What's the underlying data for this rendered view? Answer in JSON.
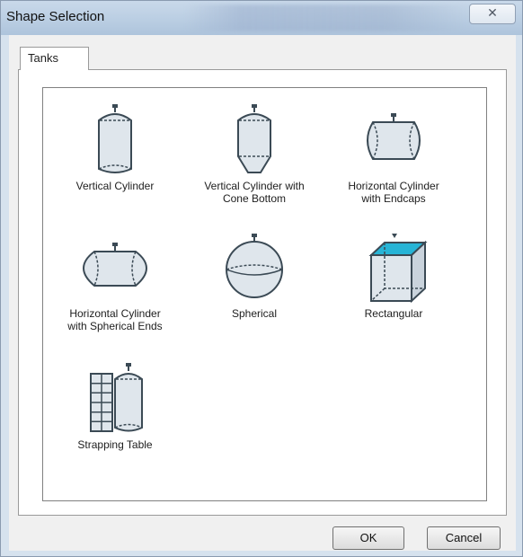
{
  "window": {
    "title": "Shape Selection",
    "close_glyph": "✕"
  },
  "tabs": [
    {
      "label": "Tanks",
      "active": true
    }
  ],
  "shapes": [
    {
      "label_lines": [
        "Vertical Cylinder"
      ],
      "icon": "vertical-cylinder-icon"
    },
    {
      "label_lines": [
        "Vertical Cylinder with",
        "Cone Bottom"
      ],
      "icon": "vertical-cylinder-cone-bottom-icon"
    },
    {
      "label_lines": [
        "Horizontal Cylinder",
        "with Endcaps"
      ],
      "icon": "horizontal-cylinder-endcaps-icon"
    },
    {
      "label_lines": [
        "Horizontal Cylinder",
        "with Spherical Ends"
      ],
      "icon": "horizontal-cylinder-spherical-ends-icon"
    },
    {
      "label_lines": [
        "Spherical"
      ],
      "icon": "spherical-tank-icon"
    },
    {
      "label_lines": [
        "Rectangular"
      ],
      "icon": "rectangular-tank-icon"
    },
    {
      "label_lines": [
        "Strapping Table"
      ],
      "icon": "strapping-table-icon"
    }
  ],
  "buttons": {
    "ok": "OK",
    "cancel": "Cancel"
  },
  "colors": {
    "tank_fill": "#dfe6ec",
    "tank_stroke": "#3b4a55",
    "liquid_accent": "#27b4d6",
    "window_frame": "#d6e2ee"
  }
}
